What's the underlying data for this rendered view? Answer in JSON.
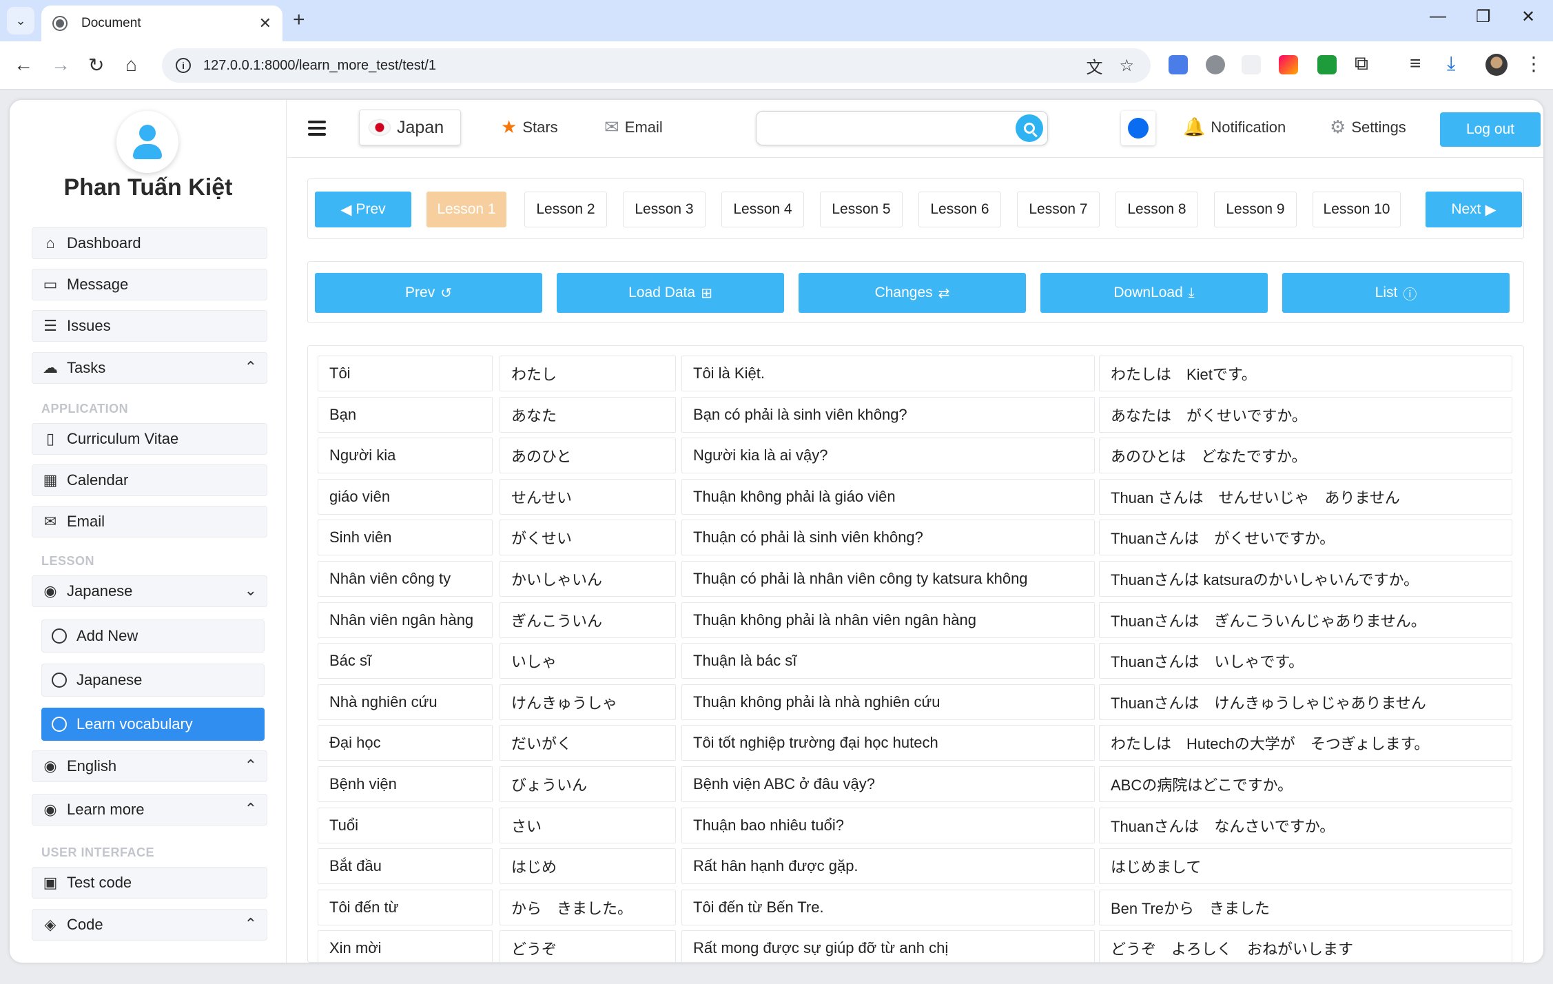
{
  "browser": {
    "tab_title": "Document",
    "url": "127.0.0.1:8000/learn_more_test/test/1"
  },
  "sidebar": {
    "user_name": "Phan Tuấn Kiệt",
    "top_items": [
      {
        "label": "Dashboard",
        "icon": "home-icon"
      },
      {
        "label": "Message",
        "icon": "chat-icon"
      },
      {
        "label": "Issues",
        "icon": "stack-icon"
      },
      {
        "label": "Tasks",
        "icon": "cloud-icon"
      }
    ],
    "section_application": "APPLICATION",
    "app_items": [
      {
        "label": "Curriculum Vitae",
        "icon": "document-icon"
      },
      {
        "label": "Calendar",
        "icon": "calendar-icon"
      },
      {
        "label": "Email",
        "icon": "mail-icon"
      }
    ],
    "section_lesson": "LESSON",
    "lesson_group": {
      "label": "Japanese",
      "icon": "flame-icon"
    },
    "lesson_subitems": [
      {
        "label": "Add New"
      },
      {
        "label": "Japanese"
      },
      {
        "label": "Learn vocabulary",
        "active": true
      }
    ],
    "other_groups": [
      {
        "label": "English",
        "icon": "flame-icon"
      },
      {
        "label": "Learn more",
        "icon": "flame-icon"
      }
    ],
    "section_ui": "USER INTERFACE",
    "ui_items": [
      {
        "label": "Test code",
        "icon": "laptop-icon"
      },
      {
        "label": "Code",
        "icon": "codepen-icon"
      }
    ]
  },
  "topbar": {
    "language": "Japan",
    "stars": "Stars",
    "email": "Email",
    "search_placeholder": "",
    "notification": "Notification",
    "settings": "Settings",
    "logout": "Log out",
    "accent_color": "#3db6f5",
    "picked_color": "#0a6cf0"
  },
  "lessons": {
    "prev": "Prev",
    "next": "Next",
    "current_index": 0,
    "items": [
      "Lesson 1",
      "Lesson 2",
      "Lesson 3",
      "Lesson 4",
      "Lesson 5",
      "Lesson 6",
      "Lesson 7",
      "Lesson 8",
      "Lesson 9",
      "Lesson 10"
    ]
  },
  "actions": [
    {
      "label": "Prev",
      "icon": "undo-icon"
    },
    {
      "label": "Load Data",
      "icon": "windows-icon"
    },
    {
      "label": "Changes",
      "icon": "exchange-icon"
    },
    {
      "label": "DownLoad",
      "icon": "download-icon"
    },
    {
      "label": "List",
      "icon": "info-icon"
    }
  ],
  "vocabulary": [
    [
      "Tôi",
      "わたし",
      "Tôi là Kiệt.",
      "わたしは　Kietです。"
    ],
    [
      "Bạn",
      "あなた",
      "Bạn có phải là sinh viên không?",
      "あなたは　がくせいですか。"
    ],
    [
      "Người kia",
      "あのひと",
      "Người kia là ai vậy?",
      "あのひとは　どなたですか。"
    ],
    [
      "giáo viên",
      "せんせい",
      "Thuận không phải là giáo viên",
      "Thuan さんは　せんせいじゃ　ありません"
    ],
    [
      "Sinh viên",
      "がくせい",
      "Thuận có phải là sinh viên không?",
      "Thuanさんは　がくせいですか。"
    ],
    [
      "Nhân viên công ty",
      "かいしゃいん",
      "Thuận có phải là nhân viên công ty katsura không",
      "Thuanさんは katsuraのかいしゃいんですか。"
    ],
    [
      "Nhân viên ngân hàng",
      "ぎんこういん",
      "Thuận không phải là nhân viên ngân hàng",
      "Thuanさんは　ぎんこういんじゃありません。"
    ],
    [
      "Bác sĩ",
      "いしゃ",
      "Thuận là bác sĩ",
      "Thuanさんは　いしゃです。"
    ],
    [
      "Nhà nghiên cứu",
      "けんきゅうしゃ",
      "Thuận không phải là nhà nghiên cứu",
      "Thuanさんは　けんきゅうしゃじゃありません"
    ],
    [
      "Đại học",
      "だいがく",
      "Tôi tốt nghiệp trường đại học hutech",
      "わたしは　Hutechの大学が　そつぎょします。"
    ],
    [
      "Bệnh viện",
      "びょういん",
      "Bệnh viện ABC ở đâu vậy?",
      "ABCの病院はどこですか。"
    ],
    [
      "Tuổi",
      "さい",
      "Thuận bao nhiêu tuổi?",
      "Thuanさんは　なんさいですか。"
    ],
    [
      "Bắt đầu",
      "はじめ",
      "Rất hân hạnh được gặp.",
      "はじめまして"
    ],
    [
      "Tôi đến từ",
      "から　きました。",
      "Tôi đến từ Bến Tre.",
      "Ben Treから　きました"
    ],
    [
      "Xin mời",
      "どうぞ",
      "Rất mong được sự giúp đỡ từ anh chị",
      "どうぞ　よろしく　おねがいします"
    ]
  ]
}
